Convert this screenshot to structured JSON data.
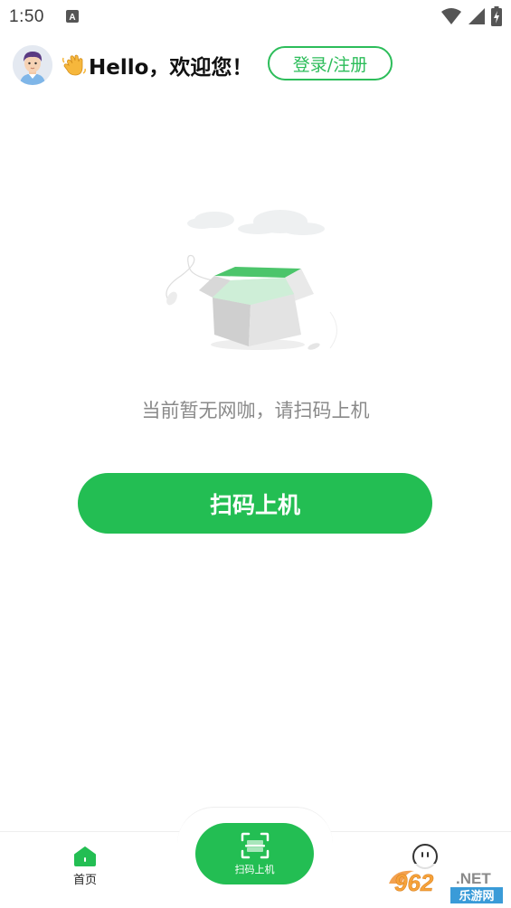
{
  "status_bar": {
    "time": "1:50",
    "icons": [
      "notification-a-icon",
      "wifi-icon",
      "signal-icon",
      "battery-charging-icon"
    ]
  },
  "header": {
    "greeting": "Hello，欢迎您！",
    "wave_icon": "waving-hand-icon",
    "login_label": "登录/注册"
  },
  "empty_state": {
    "illustration": "empty-box-icon",
    "message": "当前暂无网咖，请扫码上机"
  },
  "main": {
    "scan_button_label": "扫码上机"
  },
  "bottom_nav": {
    "home_label": "首页",
    "scan_label": "扫码上机"
  },
  "watermark": {
    "brand": "962",
    "suffix": ".NET",
    "subtitle": "乐游网"
  },
  "colors": {
    "accent": "#23be53",
    "text_muted": "#8a8a8a"
  }
}
